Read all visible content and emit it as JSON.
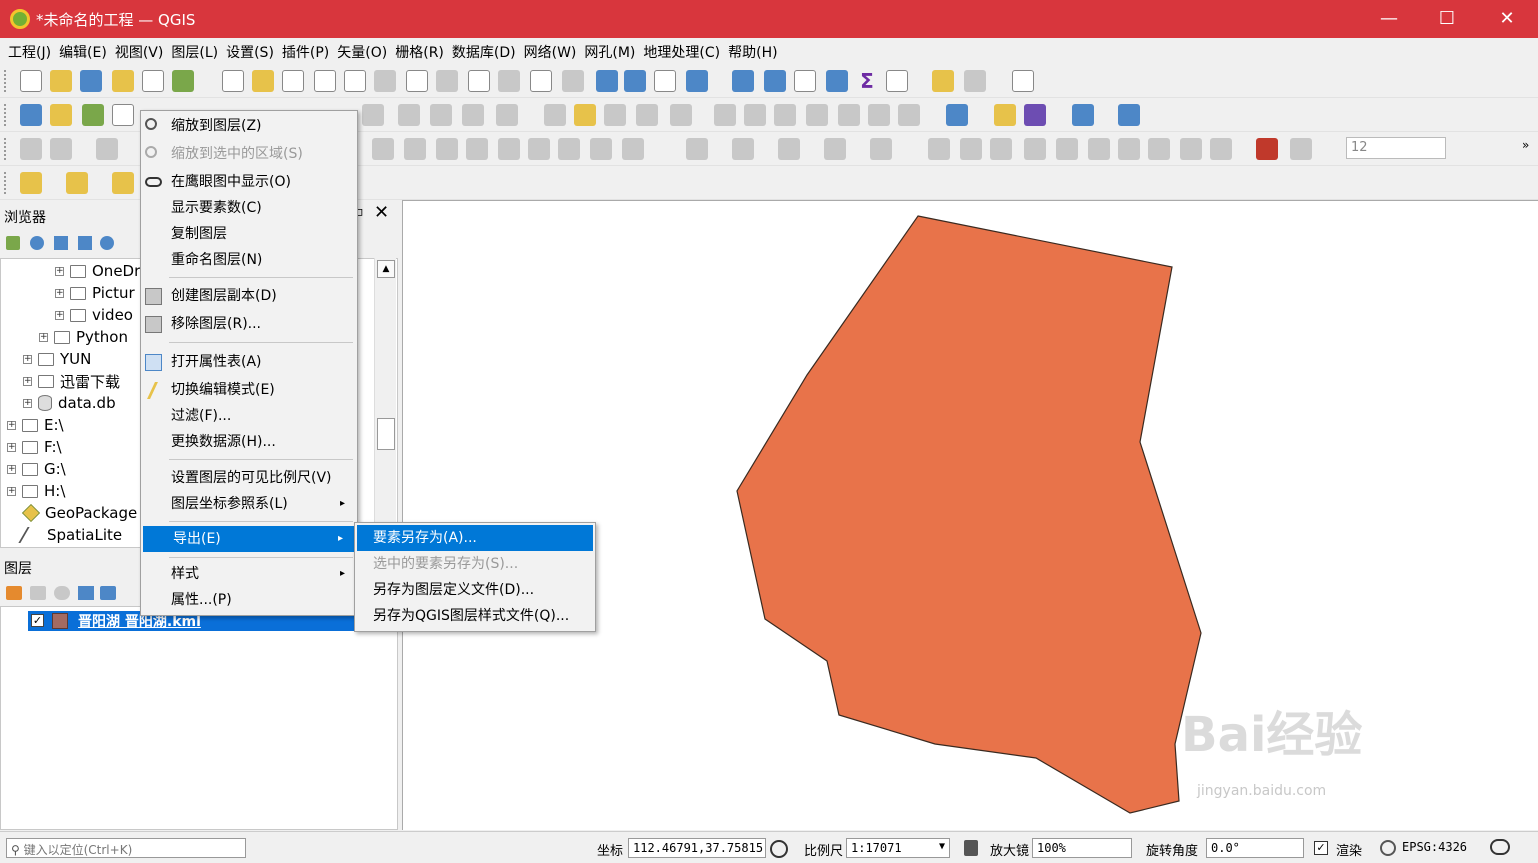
{
  "window": {
    "title": "*未命名的工程 — QGIS",
    "minimize": "—",
    "maximize": "☐",
    "close": "✕"
  },
  "menubar": [
    "工程(J)",
    "编辑(E)",
    "视图(V)",
    "图层(L)",
    "设置(S)",
    "插件(P)",
    "矢量(O)",
    "栅格(R)",
    "数据库(D)",
    "网络(W)",
    "网孔(M)",
    "地理处理(C)",
    "帮助(H)"
  ],
  "toolbar": {
    "scale_spin_value": "12"
  },
  "browser": {
    "title": "浏览器",
    "tree": [
      {
        "label": "OneDr"
      },
      {
        "label": "Pictur"
      },
      {
        "label": "video"
      },
      {
        "label": "Python"
      },
      {
        "label": "YUN"
      },
      {
        "label": "迅雷下载"
      },
      {
        "label": "data.db"
      },
      {
        "label": "E:\\"
      },
      {
        "label": "F:\\"
      },
      {
        "label": "G:\\"
      },
      {
        "label": "H:\\"
      },
      {
        "label": "GeoPackage"
      },
      {
        "label": "SpatiaLite"
      }
    ]
  },
  "layers": {
    "title": "图层",
    "selected_layer": "晋阳湖 晋阳湖.kml"
  },
  "context_menu": {
    "items": [
      {
        "label": "缩放到图层(Z)"
      },
      {
        "label": "缩放到选中的区域(S)"
      },
      {
        "label": "在鹰眼图中显示(O)"
      },
      {
        "label": "显示要素数(C)"
      },
      {
        "label": "复制图层"
      },
      {
        "label": "重命名图层(N)"
      },
      {
        "label": "创建图层副本(D)"
      },
      {
        "label": "移除图层(R)..."
      },
      {
        "label": "打开属性表(A)"
      },
      {
        "label": "切换编辑模式(E)"
      },
      {
        "label": "过滤(F)..."
      },
      {
        "label": "更换数据源(H)..."
      },
      {
        "label": "设置图层的可见比例尺(V)"
      },
      {
        "label": "图层坐标参照系(L)"
      },
      {
        "label": "导出(E)"
      },
      {
        "label": "样式"
      },
      {
        "label": "属性...(P)"
      }
    ]
  },
  "export_submenu": {
    "items": [
      {
        "label": "要素另存为(A)..."
      },
      {
        "label": "选中的要素另存为(S)..."
      },
      {
        "label": "另存为图层定义文件(D)..."
      },
      {
        "label": "另存为QGIS图层样式文件(Q)..."
      }
    ]
  },
  "map": {
    "polygon_fill": "#e8734a",
    "polygon_stroke": "#3a2a20"
  },
  "statusbar": {
    "locator_placeholder": "键入以定位(Ctrl+K)",
    "coord_label": "坐标",
    "coord_value": "112.46791,37.75815",
    "scale_label": "比例尺",
    "scale_value": "1:17071",
    "magnifier_label": "放大镜",
    "magnifier_value": "100%",
    "rotation_label": "旋转角度",
    "rotation_value": "0.0°",
    "render_label": "渲染",
    "epsg": "EPSG:4326"
  },
  "watermark": {
    "brand": "Bai经验",
    "url": "jingyan.baidu.com"
  }
}
